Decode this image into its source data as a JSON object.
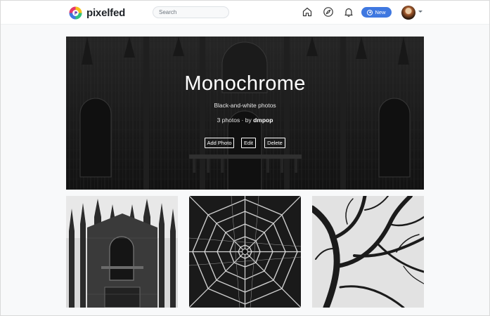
{
  "brand": {
    "name": "pixelfed"
  },
  "search": {
    "placeholder": "Search"
  },
  "nav": {
    "new_label": "New"
  },
  "collection": {
    "title": "Monochrome",
    "description": "Black-and-white photos",
    "count_text": "3 photos · by",
    "author": "dmpop",
    "actions": {
      "add": "Add Photo",
      "edit": "Edit",
      "delete": "Delete"
    }
  },
  "photos": [
    {
      "subject": "cathedral-facade"
    },
    {
      "subject": "octagonal-glass-dome"
    },
    {
      "subject": "bare-tree-branches"
    }
  ],
  "colors": {
    "accent": "#3f78e0",
    "navbar": "#ffffff",
    "background": "#f8f9fa"
  }
}
